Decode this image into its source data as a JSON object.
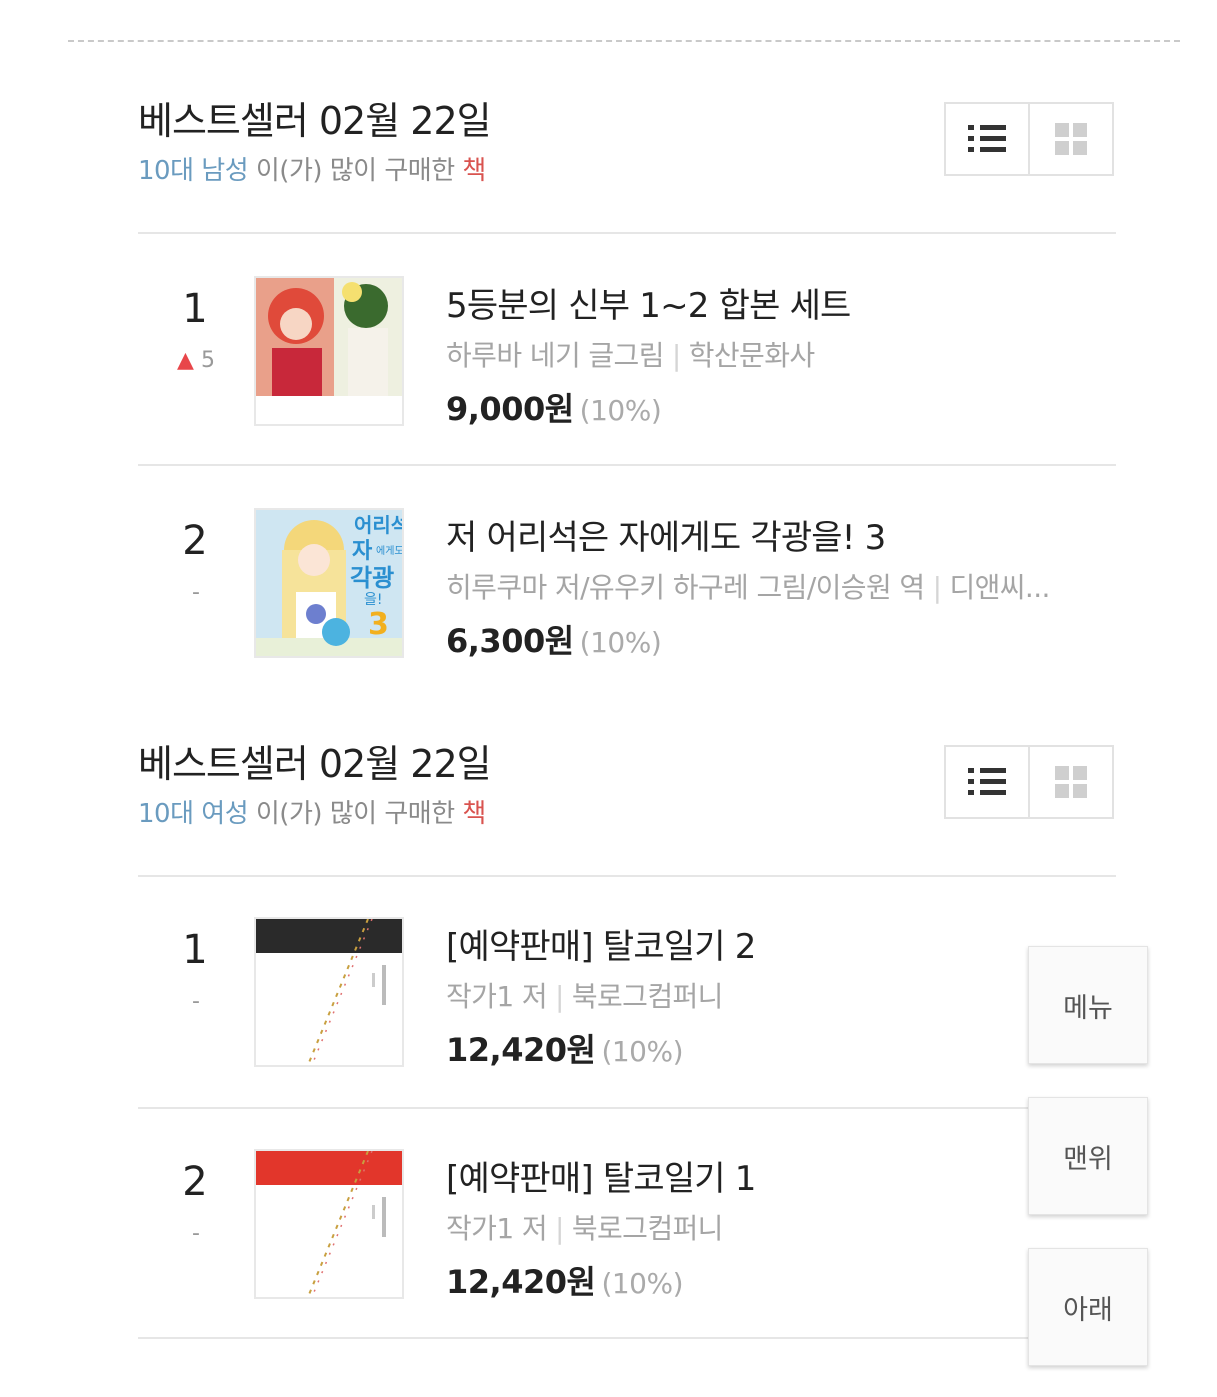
{
  "sections": [
    {
      "title": "베스트셀러 02월 22일",
      "subtitle": {
        "segment": "10대 남성",
        "middle": " 이(가) 많이 구매한 ",
        "end": "책"
      },
      "items": [
        {
          "rank": "1",
          "change_arrow": "▲",
          "change": "5",
          "title": "5등분의 신부 1~2 합본 세트",
          "author": "하루바 네기 글그림",
          "publisher": "학산문화사",
          "price": "9,000원",
          "discount": "(10%)",
          "cover_icon": "manga-cover-image"
        },
        {
          "rank": "2",
          "change": "-",
          "title": "저 어리석은 자에게도 각광을! 3",
          "author": "히루쿠마 저/유우키 하구레 그림/이승원 역",
          "publisher": "디앤씨...",
          "price": "6,300원",
          "discount": "(10%)",
          "cover_icon": "light-novel-cover-image",
          "cover_text": {
            "line1": "어리석",
            "line2": "자",
            "line3": "에게도",
            "line4": "각광",
            "line5": "을!",
            "num": "3"
          }
        }
      ]
    },
    {
      "title": "베스트셀러 02월 22일",
      "subtitle": {
        "segment": "10대 여성",
        "middle": " 이(가) 많이 구매한 ",
        "end": "책"
      },
      "items": [
        {
          "rank": "1",
          "change": "-",
          "title": "[예약판매] 탈코일기 2",
          "author": "작가1 저",
          "publisher": "북로그컴퍼니",
          "price": "12,420원",
          "discount": "(10%)",
          "cover_icon": "book-cover-black-band",
          "band_color": "#2a2a2a"
        },
        {
          "rank": "2",
          "change": "-",
          "title": "[예약판매] 탈코일기 1",
          "author": "작가1 저",
          "publisher": "북로그컴퍼니",
          "price": "12,420원",
          "discount": "(10%)",
          "cover_icon": "book-cover-red-band",
          "band_color": "#e2362b"
        }
      ]
    }
  ],
  "floating_buttons": {
    "menu": "메뉴",
    "top": "맨위",
    "down": "아래"
  },
  "colors": {
    "accent_blue": "#6a9bbf",
    "accent_red": "#d9534f",
    "rank_up": "#e8464a"
  }
}
